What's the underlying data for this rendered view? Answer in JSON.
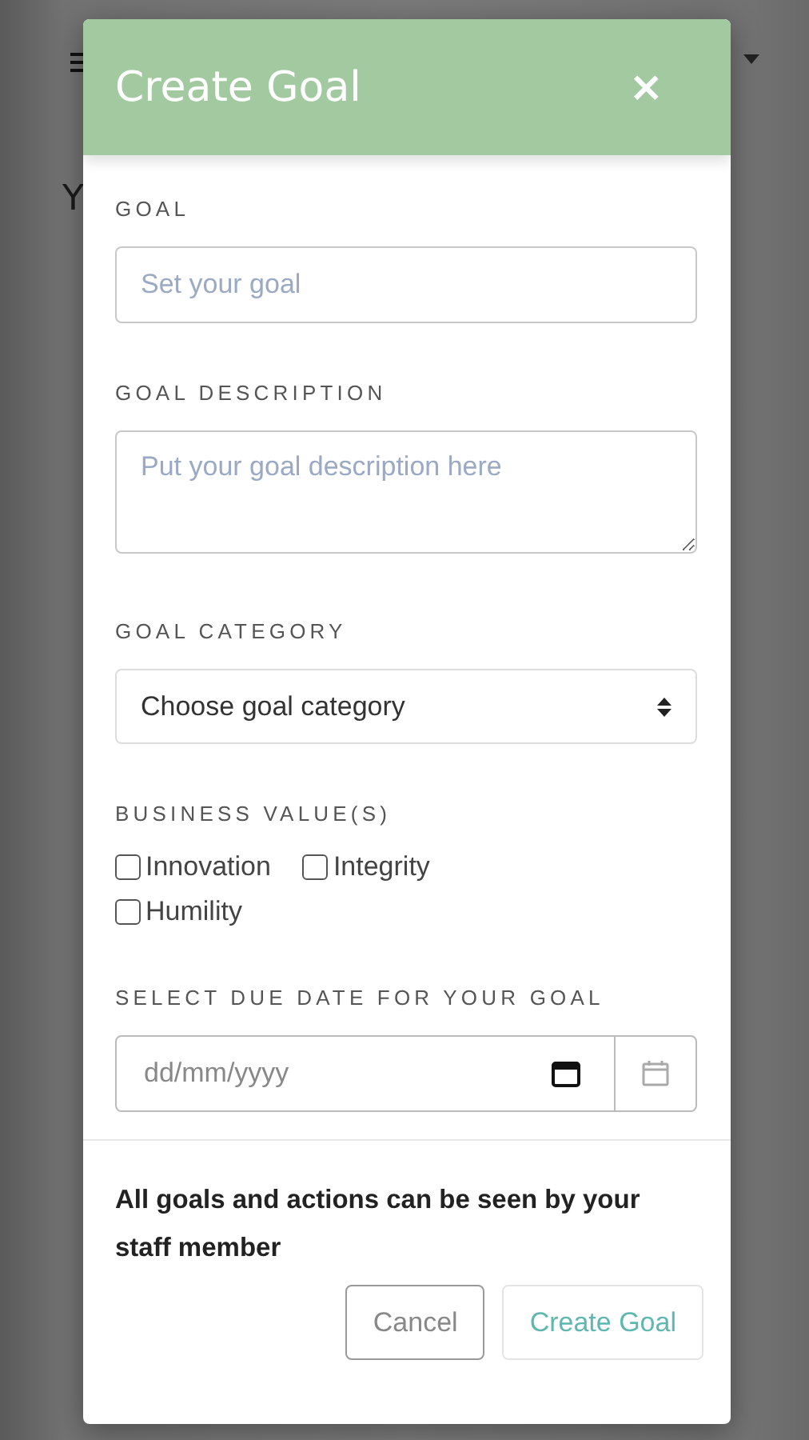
{
  "background": {
    "heading": "Y"
  },
  "modal": {
    "title": "Create Goal",
    "close": "×"
  },
  "fields": [
    {
      "kind": "text",
      "label": "GOAL",
      "placeholder": "Set your goal"
    },
    {
      "kind": "textarea",
      "label": "GOAL DESCRIPTION",
      "placeholder": "Put your goal description here"
    },
    {
      "kind": "select",
      "label": "GOAL CATEGORY",
      "value": "Choose goal category"
    },
    {
      "kind": "checkboxes",
      "label": "BUSINESS VALUE(S)",
      "options": [
        {
          "label": "Innovation",
          "checked": false
        },
        {
          "label": "Integrity",
          "checked": false
        },
        {
          "label": "Humility",
          "checked": false
        }
      ]
    },
    {
      "kind": "date",
      "label": "SELECT DUE DATE FOR YOUR GOAL",
      "placeholder": "dd/mm/yyyy"
    }
  ],
  "note": "All goals and actions can be seen by your staff member",
  "buttons": [
    {
      "kind": "secondary",
      "label": "Cancel"
    },
    {
      "kind": "primary",
      "label": "Create Goal"
    }
  ]
}
